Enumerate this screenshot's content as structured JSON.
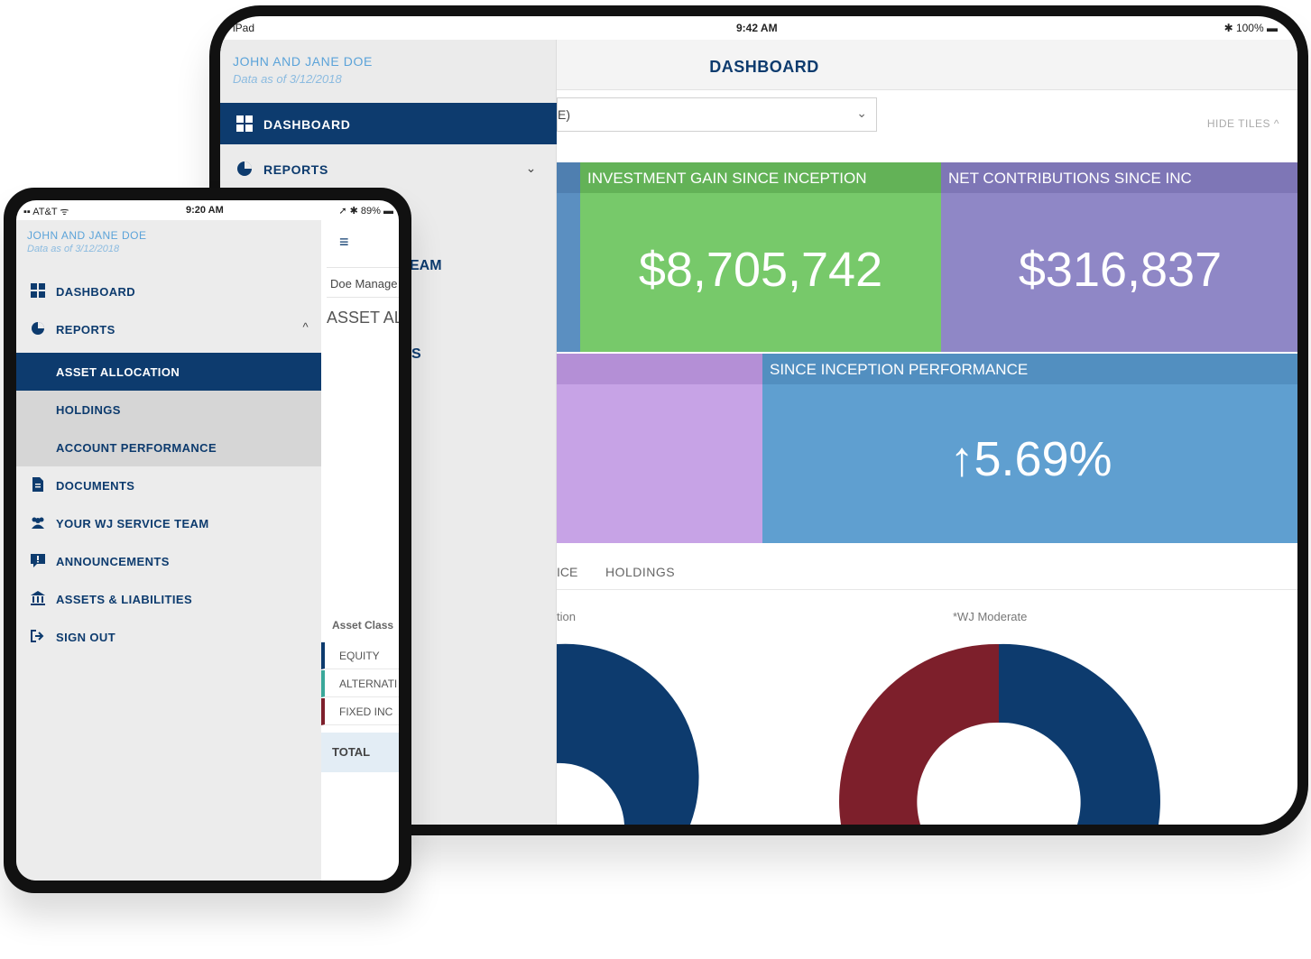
{
  "ipad": {
    "status": {
      "device": "iPad",
      "time": "9:42 AM",
      "battery": "100%"
    },
    "header_title": "DASHBOARD",
    "sidebar": {
      "client_name": "JOHN AND JANE DOE",
      "as_of": "Data as of 3/12/2018",
      "items": [
        {
          "label": "DASHBOARD",
          "icon": "dashboard-icon",
          "active": true
        },
        {
          "label": "REPORTS",
          "icon": "pie-chart-icon",
          "chevron": "chevron-down"
        }
      ],
      "peek_1": "EAM",
      "peek_2": "S"
    },
    "select_value": "E)",
    "hide_tiles": "HIDE TILES",
    "tiles": [
      {
        "header": "INVESTMENT GAIN SINCE INCEPTION",
        "value": "$8,705,742"
      },
      {
        "header": "NET CONTRIBUTIONS SINCE INC",
        "value": "$316,837"
      },
      {
        "header": "SINCE INCEPTION PERFORMANCE",
        "value": "↑5.69%"
      }
    ],
    "tabs": [
      "ICE",
      "HOLDINGS"
    ],
    "chart_labels": [
      "tion",
      "*WJ Moderate"
    ],
    "colors": {
      "navy": "#0d3b6e",
      "maroon": "#7d1f2b",
      "green": "#77c96a",
      "purple": "#8f87c6",
      "violet": "#c7a3e6",
      "lightblue": "#5f9fd0"
    }
  },
  "iphone": {
    "status": {
      "carrier": "AT&T",
      "time": "9:20 AM",
      "battery": "89%"
    },
    "sidebar": {
      "client_name": "JOHN AND JANE DOE",
      "as_of": "Data as of 3/12/2018",
      "items": [
        {
          "label": "DASHBOARD",
          "icon": "dashboard-icon"
        },
        {
          "label": "REPORTS",
          "icon": "pie-chart-icon",
          "chevron": "chevron-up"
        },
        {
          "label": "ASSET ALLOCATION",
          "active": true
        },
        {
          "label": "HOLDINGS",
          "sub": true
        },
        {
          "label": "ACCOUNT PERFORMANCE",
          "sub": true
        },
        {
          "label": "DOCUMENTS",
          "icon": "document-icon"
        },
        {
          "label": "YOUR WJ SERVICE TEAM",
          "icon": "team-icon"
        },
        {
          "label": "ANNOUNCEMENTS",
          "icon": "announcement-icon"
        },
        {
          "label": "ASSETS & LIABILITIES",
          "icon": "bank-icon"
        },
        {
          "label": "SIGN OUT",
          "icon": "sign-out-icon"
        }
      ]
    },
    "content": {
      "manager": "Doe Manage",
      "heading": "ASSET AL",
      "column": "Asset Class",
      "rows": [
        "EQUITY",
        "ALTERNATI",
        "FIXED INC"
      ],
      "row_colors": [
        "#0d3b6e",
        "#3aa89a",
        "#7d1f2b"
      ],
      "total": "TOTAL"
    }
  }
}
